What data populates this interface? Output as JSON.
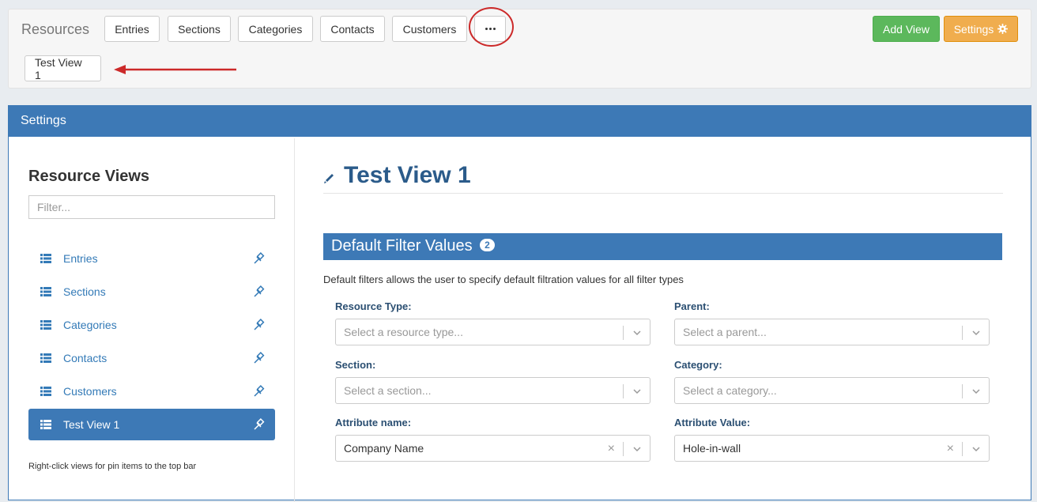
{
  "topbar": {
    "brand": "Resources",
    "tabs": [
      "Entries",
      "Sections",
      "Categories",
      "Contacts",
      "Customers"
    ],
    "more_label": "",
    "pinned_view": "Test View 1",
    "add_view": "Add View",
    "settings": "Settings"
  },
  "panel": {
    "header": "Settings"
  },
  "sidebar": {
    "title": "Resource Views",
    "filter_placeholder": "Filter...",
    "items": [
      {
        "label": "Entries",
        "active": false
      },
      {
        "label": "Sections",
        "active": false
      },
      {
        "label": "Categories",
        "active": false
      },
      {
        "label": "Contacts",
        "active": false
      },
      {
        "label": "Customers",
        "active": false
      },
      {
        "label": "Test View 1",
        "active": true
      }
    ],
    "note": "Right-click views for pin items to the top bar"
  },
  "main": {
    "title": "Test View 1",
    "section_title": "Default Filter Values",
    "section_badge": "2",
    "section_desc": "Default filters allows the user to specify default filtration values for all filter types",
    "fields": {
      "resource_type": {
        "label": "Resource Type:",
        "placeholder": "Select a resource type..."
      },
      "parent": {
        "label": "Parent:",
        "placeholder": "Select a parent..."
      },
      "section": {
        "label": "Section:",
        "placeholder": "Select a section..."
      },
      "category": {
        "label": "Category:",
        "placeholder": "Select a category..."
      },
      "attribute_name": {
        "label": "Attribute name:",
        "value": "Company Name"
      },
      "attribute_value": {
        "label": "Attribute Value:",
        "value": "Hole-in-wall"
      }
    }
  },
  "colors": {
    "primary": "#3d79b6",
    "success": "#5cb85c",
    "warning": "#f0ad4e",
    "annotation": "#cc2a2a"
  }
}
